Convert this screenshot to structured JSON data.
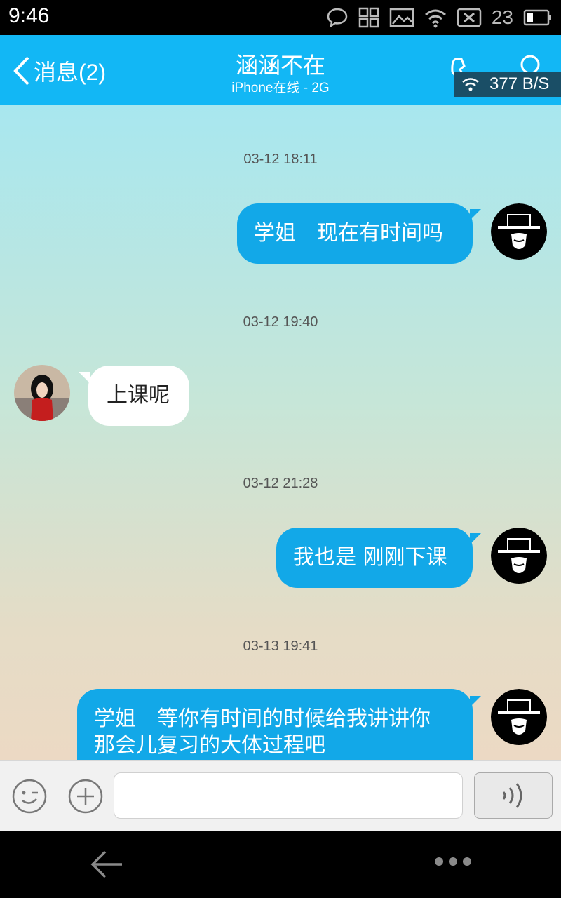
{
  "status_bar": {
    "time": "9:46",
    "battery_level": "23",
    "icons": [
      "chat-bubble-icon",
      "qr-grid-icon",
      "image-icon",
      "wifi-icon",
      "data-blocked-icon",
      "battery-icon"
    ]
  },
  "header": {
    "back_label": "消息(2)",
    "title": "涵涵不在",
    "subtitle": "iPhone在线 - 2G",
    "network_speed": "377 B/S",
    "accent_color": "#12b7f5"
  },
  "messages": [
    {
      "timestamp": "03-12 18:11",
      "direction": "out",
      "text": "学姐　现在有时间吗"
    },
    {
      "timestamp": "03-12 19:40",
      "direction": "in",
      "text": "上课呢"
    },
    {
      "timestamp": "03-12 21:28",
      "direction": "out",
      "text": "我也是 刚刚下课"
    },
    {
      "timestamp": "03-13 19:41",
      "direction": "out",
      "lines": [
        "学姐　等你有时间的时候给我讲讲你",
        "那会儿复习的大体过程吧"
      ]
    }
  ],
  "input_bar": {
    "message_value": "",
    "icons": [
      "emoji-icon",
      "plus-icon",
      "voice-icon"
    ]
  },
  "nav_bar": {
    "icons": [
      "back-arrow-icon",
      "more-dots-icon"
    ]
  },
  "colors": {
    "bubble_outgoing": "#12a8e8",
    "bubble_incoming": "#ffffff",
    "chat_bg_top": "#a8e7ef",
    "chat_bg_bottom": "#ecd9c4"
  }
}
